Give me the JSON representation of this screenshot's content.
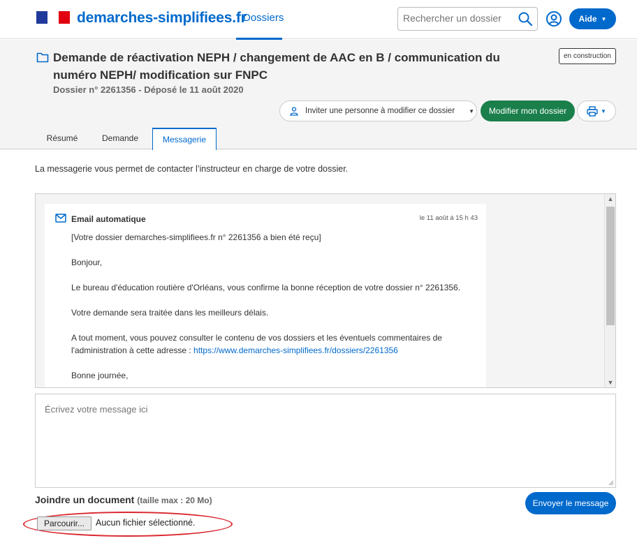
{
  "header": {
    "brand": "demarches-simplifiees.fr",
    "nav_dossiers": "Dossiers",
    "search_placeholder": "Rechercher un dossier",
    "aide_label": "Aide",
    "flag_colors": [
      "#1f3a9b",
      "#ffffff",
      "#e1000f"
    ]
  },
  "dossier": {
    "title": "Demande de réactivation NEPH / changement de AAC en B / communication du numéro NEPH/ modification sur FNPC",
    "subtitle": "Dossier n° 2261356 - Déposé le 11 août 2020",
    "status": "en construction",
    "invite_label": "Inviter une personne à modifier ce dossier",
    "modify_label": "Modifier mon dossier"
  },
  "tabs": [
    {
      "label": "Résumé",
      "active": false
    },
    {
      "label": "Demande",
      "active": false
    },
    {
      "label": "Messagerie",
      "active": true
    }
  ],
  "messagerie": {
    "intro": "La messagerie vous permet de contacter l’instructeur en charge de votre dossier.",
    "message": {
      "from": "Email automatique",
      "date": "le 11 août à 15 h 43",
      "lines": [
        "[Votre dossier demarches-simplifiees.fr n° 2261356 a bien été reçu]",
        "Bonjour,",
        "Le bureau d'éducation routière d'Orléans, vous confirme la bonne réception de votre dossier n° 2261356.",
        "Votre demande sera traitée dans les meilleurs délais.",
        "A tout moment, vous pouvez consulter le contenu de vos dossiers et les éventuels commentaires de l'administration à cette adresse : ",
        "Bonne journée,"
      ],
      "link": "https://www.demarches-simplifiees.fr/dossiers/2261356"
    },
    "compose_placeholder": "Écrivez votre message ici",
    "attach_label": "Joindre un document",
    "attach_hint": "(taille max : 20 Mo)",
    "send_label": "Envoyer le message",
    "browse_label": "Parcourir...",
    "no_file_label": "Aucun fichier sélectionné."
  },
  "colors": {
    "primary": "#0069cc",
    "success": "#1a7f4b",
    "annotation": "#d9272e"
  }
}
